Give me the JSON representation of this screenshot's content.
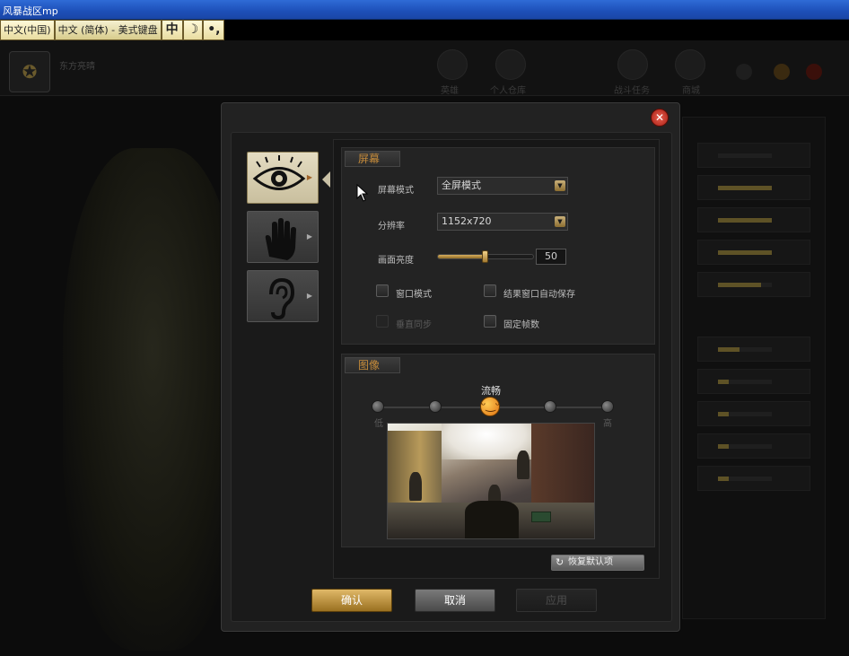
{
  "window": {
    "title": "风暴战区mp"
  },
  "ime": {
    "segments": [
      "中文(中国)",
      "中文 (简体) - 美式键盘",
      "中",
      "☽",
      "•,"
    ]
  },
  "background": {
    "player_name": "东方亮晴",
    "nav": [
      "英雄",
      "个人仓库",
      "战斗任务",
      "商城"
    ]
  },
  "dialog": {
    "close_label": "✕",
    "tabs": [
      {
        "name": "display",
        "icon": "eye-icon",
        "active": true
      },
      {
        "name": "controls",
        "icon": "hand-icon",
        "active": false
      },
      {
        "name": "audio",
        "icon": "ear-icon",
        "active": false
      }
    ],
    "screen": {
      "header": "屏幕",
      "mode_label": "屏幕模式",
      "mode_value": "全屏模式",
      "resolution_label": "分辨率",
      "resolution_value": "1152x720",
      "brightness_label": "画面亮度",
      "brightness_value": "50",
      "brightness_fraction": 0.5,
      "checkboxes": [
        {
          "label": "窗口模式",
          "checked": false,
          "enabled": true
        },
        {
          "label": "结果窗口自动保存",
          "checked": false,
          "enabled": true
        },
        {
          "label": "垂直同步",
          "checked": false,
          "enabled": false
        },
        {
          "label": "固定帧数",
          "checked": false,
          "enabled": true
        }
      ]
    },
    "image": {
      "header": "图像",
      "quality_selected_label": "流畅",
      "quality_low": "低",
      "quality_high": "高",
      "quality_levels": 5,
      "quality_selected_index": 2
    },
    "reset_label": "恢复默认项",
    "ok_label": "确认",
    "cancel_label": "取消",
    "apply_label": "应用"
  },
  "colors": {
    "accent": "#c48a3a",
    "title_bar": "#2559c4",
    "close": "#c0281a"
  }
}
